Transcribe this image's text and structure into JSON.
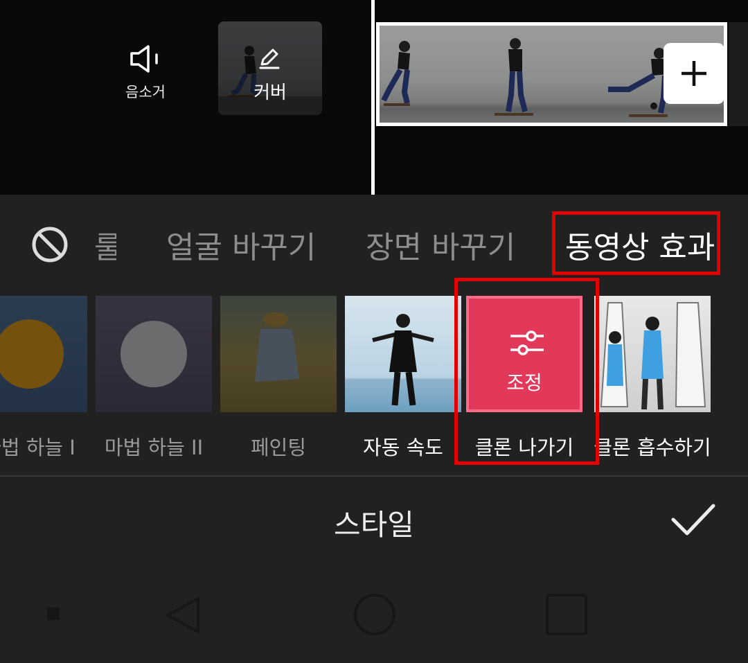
{
  "timeline": {
    "mute_label": "음소거",
    "cover_label": "커버",
    "add_clip_icon": "plus-icon"
  },
  "tabs": {
    "none_icon": "ban-icon",
    "items": [
      {
        "label": "룰",
        "state": "partial"
      },
      {
        "label": "얼굴 바꾸기",
        "state": "inactive"
      },
      {
        "label": "장면 바꾸기",
        "state": "inactive"
      },
      {
        "label": "동영상 효과",
        "state": "active"
      }
    ]
  },
  "effects": [
    {
      "label": "마법 하늘 I",
      "state": "dimmed"
    },
    {
      "label": "마법 하늘 II",
      "state": "dimmed"
    },
    {
      "label": "페인팅",
      "state": "dimmed"
    },
    {
      "label": "자동 속도",
      "state": "normal"
    },
    {
      "label": "클론 나가기",
      "state": "selected",
      "overlay_label": "조정",
      "overlay_icon": "sliders-icon"
    },
    {
      "label": "클론 흡수하기",
      "state": "normal"
    }
  ],
  "footer": {
    "title": "스타일",
    "confirm_icon": "check-icon"
  },
  "colors": {
    "highlight_box": "#e00000",
    "selected_effect": "#e2395b",
    "background": "#212121"
  }
}
